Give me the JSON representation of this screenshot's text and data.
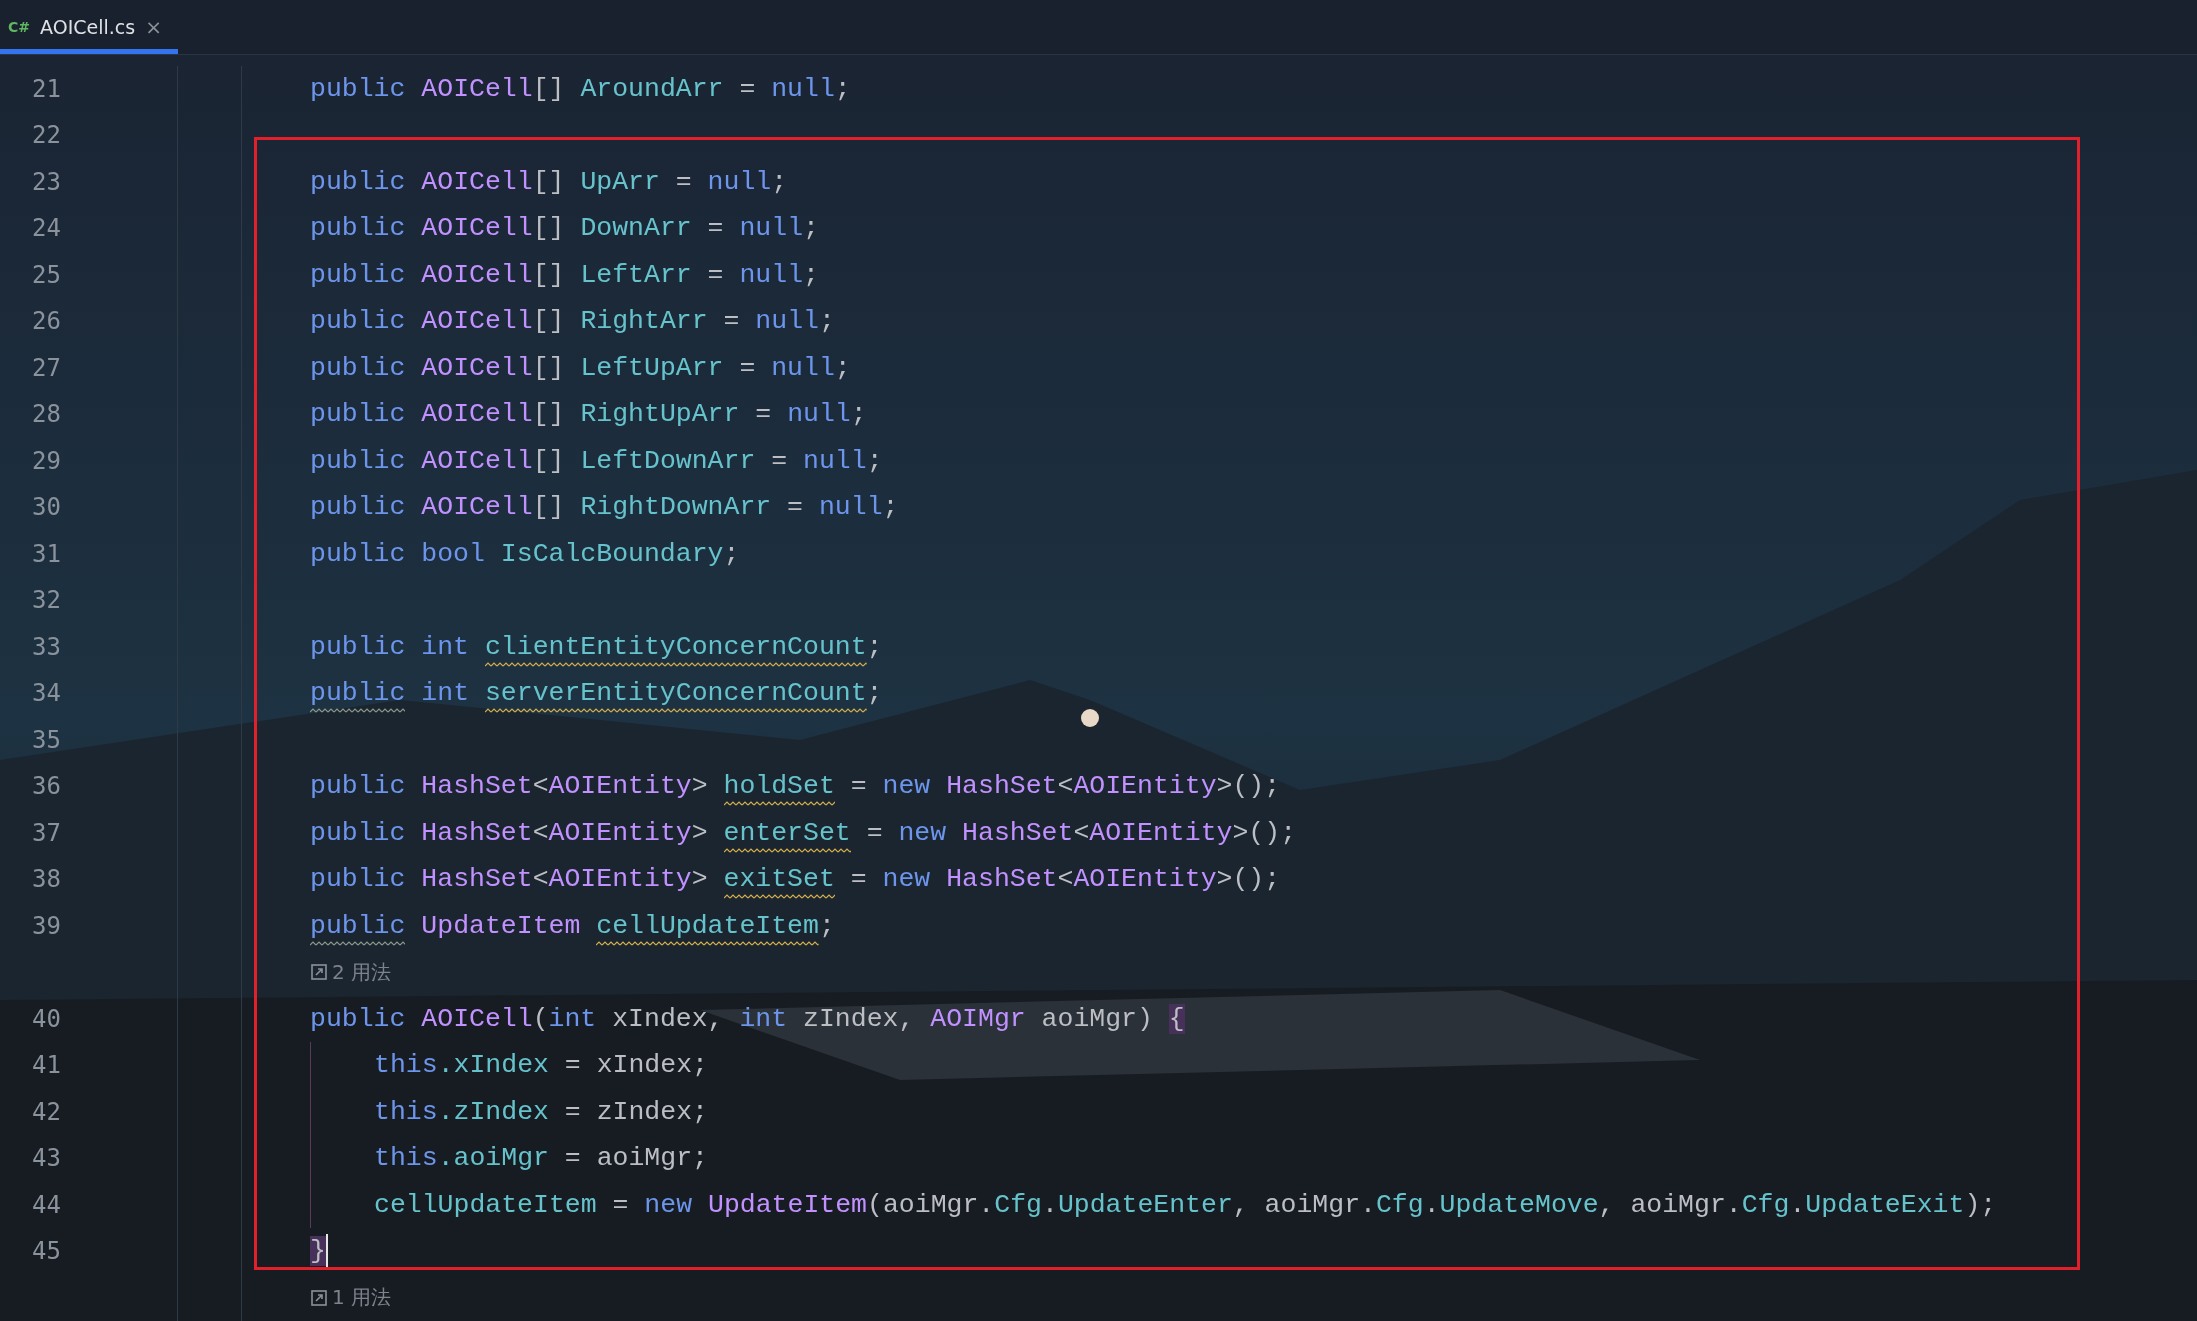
{
  "tab": {
    "lang": "C#",
    "title": "AOICell.cs",
    "close": "×",
    "selected": true
  },
  "rows": [
    {
      "kind": "code",
      "number": "21",
      "tokens": [
        {
          "kind": "kw",
          "text": "public "
        },
        {
          "kind": "type",
          "text": "AOICell"
        },
        {
          "kind": "plain",
          "text": "[] "
        },
        {
          "kind": "field",
          "text": "AroundArr"
        },
        {
          "kind": "plain",
          "text": " = "
        },
        {
          "kind": "kw",
          "text": "null"
        },
        {
          "kind": "plain",
          "text": ";"
        }
      ]
    },
    {
      "kind": "code",
      "number": "22"
    },
    {
      "kind": "code",
      "number": "23",
      "tokens": [
        {
          "kind": "kw",
          "text": "public "
        },
        {
          "kind": "type",
          "text": "AOICell"
        },
        {
          "kind": "plain",
          "text": "[] "
        },
        {
          "kind": "field",
          "text": "UpArr"
        },
        {
          "kind": "plain",
          "text": " = "
        },
        {
          "kind": "kw",
          "text": "null"
        },
        {
          "kind": "plain",
          "text": ";"
        }
      ]
    },
    {
      "kind": "code",
      "number": "24",
      "tokens": [
        {
          "kind": "kw",
          "text": "public "
        },
        {
          "kind": "type",
          "text": "AOICell"
        },
        {
          "kind": "plain",
          "text": "[] "
        },
        {
          "kind": "field",
          "text": "DownArr"
        },
        {
          "kind": "plain",
          "text": " = "
        },
        {
          "kind": "kw",
          "text": "null"
        },
        {
          "kind": "plain",
          "text": ";"
        }
      ]
    },
    {
      "kind": "code",
      "number": "25",
      "tokens": [
        {
          "kind": "kw",
          "text": "public "
        },
        {
          "kind": "type",
          "text": "AOICell"
        },
        {
          "kind": "plain",
          "text": "[] "
        },
        {
          "kind": "field",
          "text": "LeftArr"
        },
        {
          "kind": "plain",
          "text": " = "
        },
        {
          "kind": "kw",
          "text": "null"
        },
        {
          "kind": "plain",
          "text": ";"
        }
      ]
    },
    {
      "kind": "code",
      "number": "26",
      "tokens": [
        {
          "kind": "kw",
          "text": "public "
        },
        {
          "kind": "type",
          "text": "AOICell"
        },
        {
          "kind": "plain",
          "text": "[] "
        },
        {
          "kind": "field",
          "text": "RightArr"
        },
        {
          "kind": "plain",
          "text": " = "
        },
        {
          "kind": "kw",
          "text": "null"
        },
        {
          "kind": "plain",
          "text": ";"
        }
      ]
    },
    {
      "kind": "code",
      "number": "27",
      "tokens": [
        {
          "kind": "kw",
          "text": "public "
        },
        {
          "kind": "type",
          "text": "AOICell"
        },
        {
          "kind": "plain",
          "text": "[] "
        },
        {
          "kind": "field",
          "text": "LeftUpArr"
        },
        {
          "kind": "plain",
          "text": " = "
        },
        {
          "kind": "kw",
          "text": "null"
        },
        {
          "kind": "plain",
          "text": ";"
        }
      ]
    },
    {
      "kind": "code",
      "number": "28",
      "tokens": [
        {
          "kind": "kw",
          "text": "public "
        },
        {
          "kind": "type",
          "text": "AOICell"
        },
        {
          "kind": "plain",
          "text": "[] "
        },
        {
          "kind": "field",
          "text": "RightUpArr"
        },
        {
          "kind": "plain",
          "text": " = "
        },
        {
          "kind": "kw",
          "text": "null"
        },
        {
          "kind": "plain",
          "text": ";"
        }
      ]
    },
    {
      "kind": "code",
      "number": "29",
      "tokens": [
        {
          "kind": "kw",
          "text": "public "
        },
        {
          "kind": "type",
          "text": "AOICell"
        },
        {
          "kind": "plain",
          "text": "[] "
        },
        {
          "kind": "field",
          "text": "LeftDownArr"
        },
        {
          "kind": "plain",
          "text": " = "
        },
        {
          "kind": "kw",
          "text": "null"
        },
        {
          "kind": "plain",
          "text": ";"
        }
      ]
    },
    {
      "kind": "code",
      "number": "30",
      "tokens": [
        {
          "kind": "kw",
          "text": "public "
        },
        {
          "kind": "type",
          "text": "AOICell"
        },
        {
          "kind": "plain",
          "text": "[] "
        },
        {
          "kind": "field",
          "text": "RightDownArr"
        },
        {
          "kind": "plain",
          "text": " = "
        },
        {
          "kind": "kw",
          "text": "null"
        },
        {
          "kind": "plain",
          "text": ";"
        }
      ]
    },
    {
      "kind": "code",
      "number": "31",
      "tokens": [
        {
          "kind": "kw",
          "text": "public bool "
        },
        {
          "kind": "field",
          "text": "IsCalcBoundary"
        },
        {
          "kind": "plain",
          "text": ";"
        }
      ]
    },
    {
      "kind": "code",
      "number": "32"
    },
    {
      "kind": "code",
      "number": "33",
      "tokens": [
        {
          "kind": "kw",
          "text": "public int "
        },
        {
          "kind": "field",
          "text": "clientEntityConcernCount",
          "warning": true
        },
        {
          "kind": "plain",
          "text": ";"
        }
      ]
    },
    {
      "kind": "code",
      "number": "34",
      "tokens": [
        {
          "kind": "kw",
          "text": "public",
          "weak_warning": true
        },
        {
          "kind": "kw",
          "text": " int "
        },
        {
          "kind": "field",
          "text": "serverEntityConcernCount",
          "warning": true
        },
        {
          "kind": "plain",
          "text": ";"
        }
      ]
    },
    {
      "kind": "code",
      "number": "35"
    },
    {
      "kind": "code",
      "number": "36",
      "tokens": [
        {
          "kind": "kw",
          "text": "public "
        },
        {
          "kind": "type",
          "text": "HashSet"
        },
        {
          "kind": "plain",
          "text": "<"
        },
        {
          "kind": "type",
          "text": "AOIEntity"
        },
        {
          "kind": "plain",
          "text": "> "
        },
        {
          "kind": "field",
          "text": "holdSet",
          "warning": true
        },
        {
          "kind": "plain",
          "text": " = "
        },
        {
          "kind": "kw",
          "text": "new "
        },
        {
          "kind": "type",
          "text": "HashSet"
        },
        {
          "kind": "plain",
          "text": "<"
        },
        {
          "kind": "type",
          "text": "AOIEntity"
        },
        {
          "kind": "plain",
          "text": ">();"
        }
      ]
    },
    {
      "kind": "code",
      "number": "37",
      "tokens": [
        {
          "kind": "kw",
          "text": "public "
        },
        {
          "kind": "type",
          "text": "HashSet"
        },
        {
          "kind": "plain",
          "text": "<"
        },
        {
          "kind": "type",
          "text": "AOIEntity"
        },
        {
          "kind": "plain",
          "text": "> "
        },
        {
          "kind": "field",
          "text": "enterSet",
          "warning": true
        },
        {
          "kind": "plain",
          "text": " = "
        },
        {
          "kind": "kw",
          "text": "new "
        },
        {
          "kind": "type",
          "text": "HashSet"
        },
        {
          "kind": "plain",
          "text": "<"
        },
        {
          "kind": "type",
          "text": "AOIEntity"
        },
        {
          "kind": "plain",
          "text": ">();"
        }
      ]
    },
    {
      "kind": "code",
      "number": "38",
      "tokens": [
        {
          "kind": "kw",
          "text": "public "
        },
        {
          "kind": "type",
          "text": "HashSet"
        },
        {
          "kind": "plain",
          "text": "<"
        },
        {
          "kind": "type",
          "text": "AOIEntity"
        },
        {
          "kind": "plain",
          "text": "> "
        },
        {
          "kind": "field",
          "text": "exitSet",
          "warning": true
        },
        {
          "kind": "plain",
          "text": " = "
        },
        {
          "kind": "kw",
          "text": "new "
        },
        {
          "kind": "type",
          "text": "HashSet"
        },
        {
          "kind": "plain",
          "text": "<"
        },
        {
          "kind": "type",
          "text": "AOIEntity"
        },
        {
          "kind": "plain",
          "text": ">();"
        }
      ]
    },
    {
      "kind": "code",
      "number": "39",
      "tokens": [
        {
          "kind": "kw",
          "text": "public",
          "weak_warning": true
        },
        {
          "kind": "type",
          "text": " UpdateItem "
        },
        {
          "kind": "field",
          "text": "cellUpdateItem",
          "warning": true
        },
        {
          "kind": "plain",
          "text": ";"
        }
      ]
    },
    {
      "kind": "hint",
      "text": "2 用法"
    },
    {
      "kind": "code",
      "number": "40",
      "tokens": [
        {
          "kind": "kw",
          "text": "public "
        },
        {
          "kind": "type",
          "text": "AOICell"
        },
        {
          "kind": "plain",
          "text": "("
        },
        {
          "kind": "kw",
          "text": "int "
        },
        {
          "kind": "plain",
          "text": "xIndex, "
        },
        {
          "kind": "kw",
          "text": "int "
        },
        {
          "kind": "plain",
          "text": "zIndex, "
        },
        {
          "kind": "type",
          "text": "AOIMgr "
        },
        {
          "kind": "plain",
          "text": "aoiMgr) "
        },
        {
          "kind": "plain",
          "text": "{",
          "matched": true
        }
      ],
      "children": [
        {
          "kind": "code",
          "number": "41",
          "tokens": [
            {
              "kind": "kw",
              "text": "this"
            },
            {
              "kind": "field",
              "text": ".xIndex"
            },
            {
              "kind": "plain",
              "text": " = xIndex;"
            }
          ]
        },
        {
          "kind": "code",
          "number": "42",
          "tokens": [
            {
              "kind": "kw",
              "text": "this"
            },
            {
              "kind": "field",
              "text": ".zIndex"
            },
            {
              "kind": "plain",
              "text": " = zIndex;"
            }
          ]
        },
        {
          "kind": "code",
          "number": "43",
          "tokens": [
            {
              "kind": "kw",
              "text": "this"
            },
            {
              "kind": "field",
              "text": ".aoiMgr"
            },
            {
              "kind": "plain",
              "text": " = aoiMgr;"
            }
          ]
        },
        {
          "kind": "code",
          "number": "44",
          "tokens": [
            {
              "kind": "field",
              "text": "cellUpdateItem"
            },
            {
              "kind": "plain",
              "text": " = "
            },
            {
              "kind": "kw",
              "text": "new "
            },
            {
              "kind": "type",
              "text": "UpdateItem"
            },
            {
              "kind": "plain",
              "text": "(aoiMgr."
            },
            {
              "kind": "field",
              "text": "Cfg"
            },
            {
              "kind": "plain",
              "text": "."
            },
            {
              "kind": "field",
              "text": "UpdateEnter"
            },
            {
              "kind": "plain",
              "text": ", aoiMgr."
            },
            {
              "kind": "field",
              "text": "Cfg"
            },
            {
              "kind": "plain",
              "text": "."
            },
            {
              "kind": "field",
              "text": "UpdateMove"
            },
            {
              "kind": "plain",
              "text": ", aoiMgr."
            },
            {
              "kind": "field",
              "text": "Cfg"
            },
            {
              "kind": "plain",
              "text": "."
            },
            {
              "kind": "field",
              "text": "UpdateExit"
            },
            {
              "kind": "plain",
              "text": ");"
            }
          ]
        }
      ]
    },
    {
      "kind": "code",
      "number": "45",
      "caret": true,
      "tokens": [
        {
          "kind": "plain",
          "text": "}",
          "matched": true
        }
      ]
    },
    {
      "kind": "hint",
      "text": "1 用法"
    }
  ]
}
